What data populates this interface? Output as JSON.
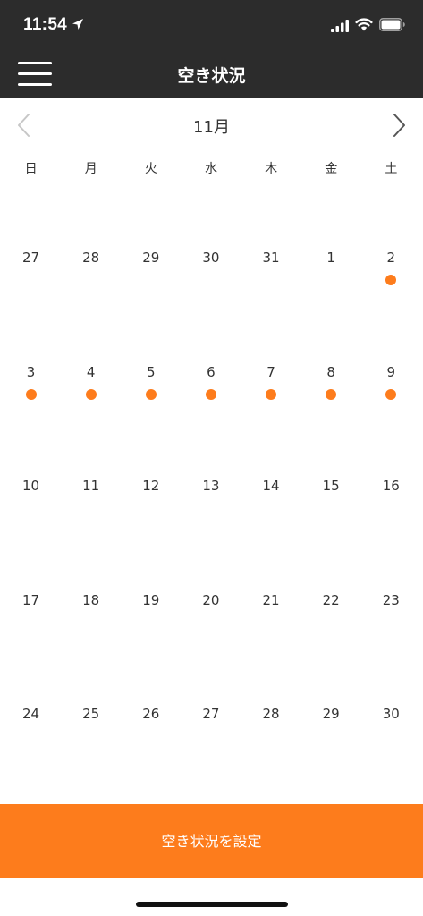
{
  "status_bar": {
    "time": "11:54",
    "icons": [
      "location-arrow-icon",
      "cellular-signal-icon",
      "wifi-icon",
      "battery-icon"
    ]
  },
  "header": {
    "title": "空き状況",
    "menu_icon": "hamburger-menu-icon"
  },
  "calendar": {
    "month_label": "11月",
    "prev_icon": "chevron-left-icon",
    "next_icon": "chevron-right-icon",
    "weekdays": [
      "日",
      "月",
      "火",
      "水",
      "木",
      "金",
      "土"
    ],
    "weeks": [
      [
        {
          "n": "27",
          "dot": false
        },
        {
          "n": "28",
          "dot": false
        },
        {
          "n": "29",
          "dot": false
        },
        {
          "n": "30",
          "dot": false
        },
        {
          "n": "31",
          "dot": false
        },
        {
          "n": "1",
          "dot": false
        },
        {
          "n": "2",
          "dot": true
        }
      ],
      [
        {
          "n": "3",
          "dot": true
        },
        {
          "n": "4",
          "dot": true
        },
        {
          "n": "5",
          "dot": true
        },
        {
          "n": "6",
          "dot": true
        },
        {
          "n": "7",
          "dot": true
        },
        {
          "n": "8",
          "dot": true
        },
        {
          "n": "9",
          "dot": true
        }
      ],
      [
        {
          "n": "10",
          "dot": false
        },
        {
          "n": "11",
          "dot": false
        },
        {
          "n": "12",
          "dot": false
        },
        {
          "n": "13",
          "dot": false
        },
        {
          "n": "14",
          "dot": false
        },
        {
          "n": "15",
          "dot": false
        },
        {
          "n": "16",
          "dot": false
        }
      ],
      [
        {
          "n": "17",
          "dot": false
        },
        {
          "n": "18",
          "dot": false
        },
        {
          "n": "19",
          "dot": false
        },
        {
          "n": "20",
          "dot": false
        },
        {
          "n": "21",
          "dot": false
        },
        {
          "n": "22",
          "dot": false
        },
        {
          "n": "23",
          "dot": false
        }
      ],
      [
        {
          "n": "24",
          "dot": false
        },
        {
          "n": "25",
          "dot": false
        },
        {
          "n": "26",
          "dot": false
        },
        {
          "n": "27",
          "dot": false
        },
        {
          "n": "28",
          "dot": false
        },
        {
          "n": "29",
          "dot": false
        },
        {
          "n": "30",
          "dot": false
        }
      ]
    ]
  },
  "footer": {
    "set_button_label": "空き状況を設定"
  },
  "colors": {
    "header_bg": "#2c2c2c",
    "accent": "#fd7c1c",
    "text": "#333333"
  }
}
